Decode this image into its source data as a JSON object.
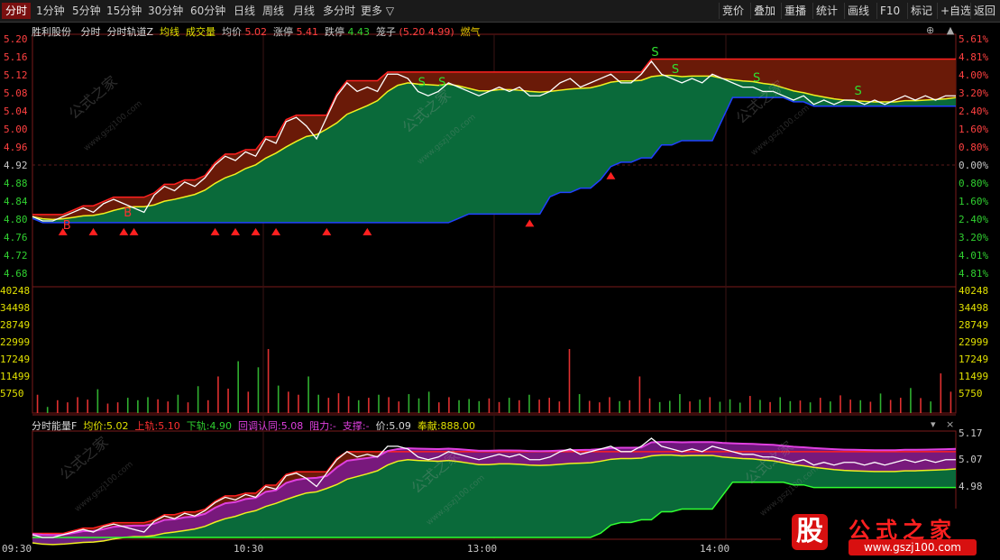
{
  "tabs": [
    {
      "label": "分时",
      "active": true
    },
    {
      "label": "1分钟"
    },
    {
      "label": "5分钟"
    },
    {
      "label": "15分钟"
    },
    {
      "label": "30分钟"
    },
    {
      "label": "60分钟"
    },
    {
      "label": "日线"
    },
    {
      "label": "周线"
    },
    {
      "label": "月线"
    },
    {
      "label": "多分时"
    },
    {
      "label": "更多 ▽"
    }
  ],
  "toolbar": [
    "竞价",
    "叠加",
    "重播",
    "统计",
    "画线",
    "F10",
    "标记",
    "+自选",
    "返回"
  ],
  "header": {
    "stock": "胜利股份",
    "view1": "分时",
    "view2": "分时轨道Z",
    "avg_line": "均线",
    "volume": "成交量",
    "avg_price_label": "均价",
    "avg_price": "5.02",
    "limit_up_label": "涨停",
    "limit_up": "5.41",
    "limit_down_label": "跌停",
    "limit_down": "4.43",
    "cage_label": "笼子",
    "cage": "(5.20 4.99)",
    "extra": "燃气"
  },
  "price_axis": [
    "5.20",
    "5.16",
    "5.12",
    "5.08",
    "5.04",
    "5.00",
    "4.96",
    "4.92",
    "4.88",
    "4.84",
    "4.80",
    "4.76",
    "4.72",
    "4.68"
  ],
  "pct_axis": [
    "5.61%",
    "4.81%",
    "4.00%",
    "3.20%",
    "2.40%",
    "1.60%",
    "0.80%",
    "0.00%",
    "0.80%",
    "1.60%",
    "2.40%",
    "3.20%",
    "4.01%",
    "4.81%"
  ],
  "vol_axis": [
    "40248",
    "34498",
    "28749",
    "22999",
    "17249",
    "11499",
    "5750"
  ],
  "lower_header": {
    "name": "分时能量F",
    "avg_label": "均价:",
    "avg": "5.02",
    "upper_label": "上轨:",
    "upper": "5.10",
    "lower_label": "下轨:",
    "lower": "4.90",
    "retrace_label": "回调认同:",
    "retrace": "5.08",
    "resist_label": "阻力:",
    "resist": "-",
    "support_label": "支撑:",
    "support": "-",
    "price_label": "价:",
    "price": "5.09",
    "follow_label": "奉献:",
    "follow": "888.00"
  },
  "lower_axis": [
    "5.17",
    "5.07",
    "4.98"
  ],
  "time_axis": [
    "09:30",
    "10:30",
    "13:00",
    "14:00"
  ],
  "watermark": {
    "text": "公式之家",
    "url": "www.gszj100.com"
  },
  "logo": {
    "badge": "股",
    "title": "公式之家",
    "url": "www.gszj100.com"
  },
  "signals": {
    "buy": "B",
    "sell": "S"
  },
  "colors": {
    "up": "#ff3030",
    "down": "#30c030",
    "band_top": "#6a1a08",
    "band_bottom": "#0a6a3a",
    "purple": "#7a1a8a"
  },
  "chart_data": {
    "type": "line",
    "price_range": [
      4.66,
      5.22
    ],
    "time_labels": [
      "09:30",
      "10:30",
      "13:00",
      "14:00"
    ],
    "price_series": [
      4.81,
      4.8,
      4.8,
      4.81,
      4.82,
      4.83,
      4.82,
      4.84,
      4.85,
      4.84,
      4.83,
      4.82,
      4.86,
      4.88,
      4.87,
      4.89,
      4.88,
      4.9,
      4.93,
      4.95,
      4.94,
      4.96,
      4.95,
      4.99,
      4.98,
      5.03,
      5.04,
      5.02,
      4.99,
      5.04,
      5.09,
      5.12,
      5.1,
      5.11,
      5.1,
      5.14,
      5.14,
      5.13,
      5.1,
      5.09,
      5.1,
      5.12,
      5.11,
      5.1,
      5.09,
      5.1,
      5.11,
      5.1,
      5.11,
      5.09,
      5.09,
      5.1,
      5.12,
      5.13,
      5.11,
      5.12,
      5.13,
      5.14,
      5.12,
      5.12,
      5.14,
      5.17,
      5.14,
      5.13,
      5.12,
      5.13,
      5.12,
      5.14,
      5.13,
      5.12,
      5.11,
      5.11,
      5.1,
      5.1,
      5.09,
      5.08,
      5.09,
      5.07,
      5.08,
      5.07,
      5.08,
      5.08,
      5.07,
      5.08,
      5.07,
      5.08,
      5.09,
      5.08,
      5.09,
      5.08,
      5.09,
      5.09
    ],
    "volume_series": [
      6000,
      2000,
      4200,
      3500,
      5200,
      4400,
      7800,
      3100,
      3500,
      5000,
      4200,
      5200,
      4500,
      3800,
      6000,
      3500,
      8800,
      4200,
      12000,
      8000,
      17000,
      7000,
      15000,
      21000,
      9000,
      7000,
      6000,
      12000,
      6000,
      5000,
      6500,
      5500,
      4200,
      5000,
      6000,
      5200,
      3800,
      6200,
      4800,
      7000,
      3500,
      5200,
      4200,
      4600,
      3900,
      4800,
      3600,
      5000,
      4200,
      6000,
      4400,
      5000,
      3800,
      21000,
      6200,
      4000,
      3500,
      5200,
      3900,
      4200,
      12000,
      4800,
      3600,
      4000,
      6200,
      3800,
      4400,
      5200,
      3700,
      4500,
      3400,
      5600,
      4300,
      3600,
      5200,
      3900,
      4100,
      3500,
      5000,
      3800,
      5800,
      4400,
      4200,
      3700,
      6400,
      4300,
      5000,
      8200,
      4900,
      3800,
      13000,
      7000
    ],
    "volume_max": 40248,
    "buy_signals": [
      3,
      9
    ],
    "sell_signals": [
      38,
      40,
      61,
      63,
      71,
      81
    ]
  }
}
